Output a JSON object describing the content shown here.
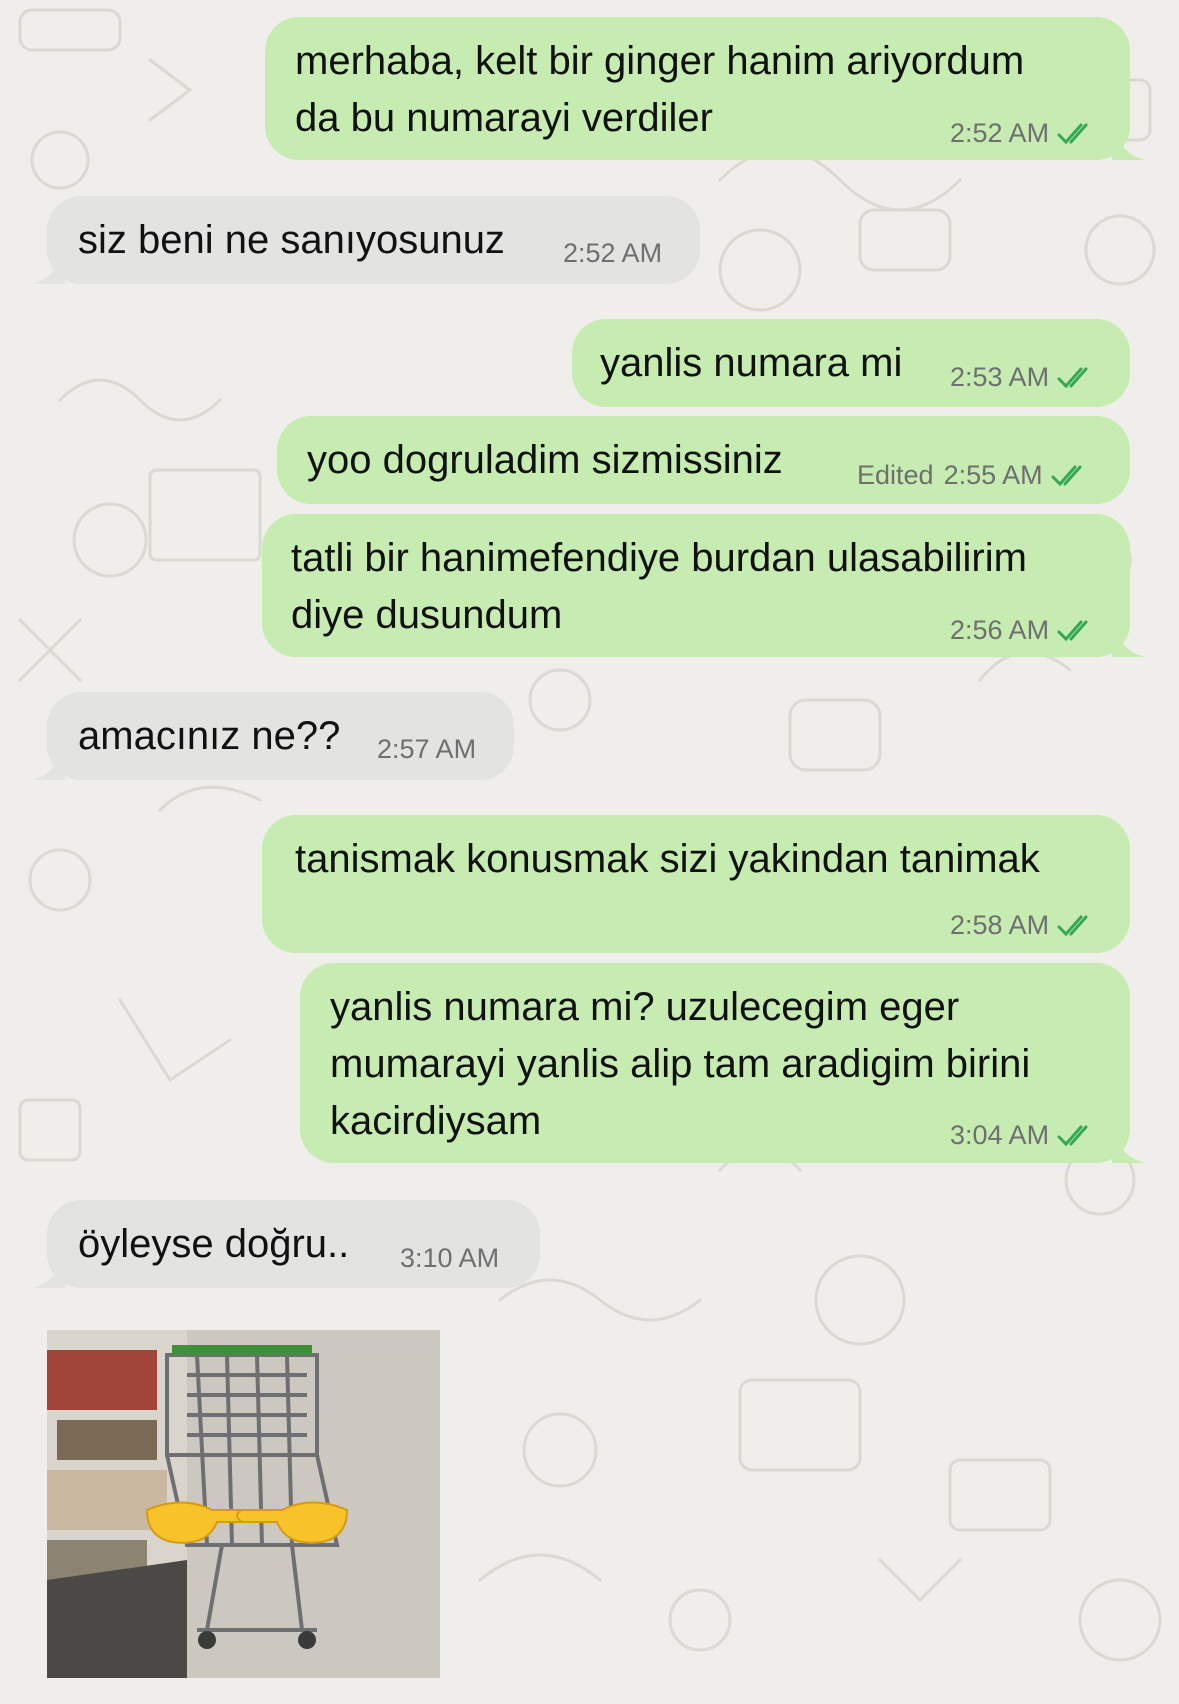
{
  "conversation": {
    "messages": [
      {
        "direction": "outgoing",
        "lines": [
          "merhaba, kelt bir ginger hanim ariyordum",
          "da bu numarayi verdiler"
        ],
        "time": "2:52 AM",
        "status": "read"
      },
      {
        "direction": "incoming",
        "lines": [
          "siz beni ne sanıyosunuz"
        ],
        "time": "2:52 AM"
      },
      {
        "direction": "outgoing",
        "lines": [
          "yanlis numara mi"
        ],
        "time": "2:53 AM",
        "status": "read"
      },
      {
        "direction": "outgoing",
        "lines": [
          "yoo dogruladim sizmissiniz"
        ],
        "edited_label": "Edited",
        "time": "2:55 AM",
        "status": "read"
      },
      {
        "direction": "outgoing",
        "lines": [
          "tatli bir hanimefendiye burdan ulasabilirim",
          "diye dusundum"
        ],
        "time": "2:56 AM",
        "status": "read"
      },
      {
        "direction": "incoming",
        "lines": [
          "amacınız ne??"
        ],
        "time": "2:57 AM"
      },
      {
        "direction": "outgoing",
        "lines": [
          "tanismak konusmak sizi yakindan tanimak"
        ],
        "time": "2:58 AM",
        "status": "read"
      },
      {
        "direction": "outgoing",
        "lines": [
          "yanlis numara mi? uzulecegim eger",
          "mumarayi yanlis alip tam aradigim birini",
          "kacirdiysam"
        ],
        "time": "3:04 AM",
        "status": "read"
      },
      {
        "direction": "incoming",
        "lines": [
          "öyleyse doğru.."
        ],
        "time": "3:10 AM"
      }
    ],
    "image_message": {
      "direction": "incoming",
      "description_icon": "shopping-cart-pointing-hands-image"
    }
  },
  "colors": {
    "background": "#efeeea",
    "outgoing_bubble": "#c6ecb2",
    "incoming_bubble": "#e3e3e1",
    "read_ticks": "#34a853",
    "timestamp": "#6f6f6f"
  }
}
